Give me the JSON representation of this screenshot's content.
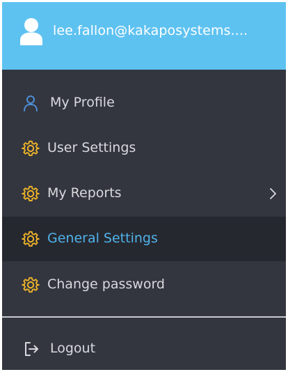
{
  "user": {
    "email": "lee.fallon@kakaposystems...."
  },
  "menu": {
    "items": [
      {
        "label": "My Profile",
        "icon": "user-icon"
      },
      {
        "label": "User Settings",
        "icon": "gear-icon"
      },
      {
        "label": "My Reports",
        "icon": "gear-icon",
        "has_submenu": true
      },
      {
        "label": "General Settings",
        "icon": "gear-icon",
        "active": true
      },
      {
        "label": "Change password",
        "icon": "gear-icon"
      }
    ],
    "logout_label": "Logout"
  },
  "colors": {
    "header_bg": "#5ec2f1",
    "menu_bg": "#33363f",
    "active_bg": "#262830",
    "active_text": "#4fb3e9",
    "gear_icon": "#f0b429",
    "profile_icon": "#4f8fd9"
  }
}
